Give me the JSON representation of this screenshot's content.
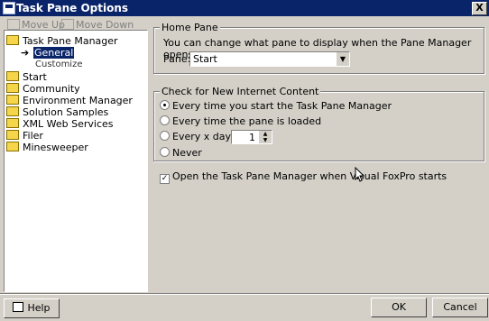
{
  "window": {
    "title": "Task Pane Options",
    "close_label": "X"
  },
  "toolbar": {
    "move_up": "Move Up",
    "move_down": "Move Down"
  },
  "tree": {
    "items": [
      "Task Pane Manager",
      "General",
      "Customize",
      "Start",
      "Community",
      "Environment Manager",
      "Solution Samples",
      "XML Web Services",
      "Filer",
      "Minesweeper"
    ]
  },
  "home_pane": {
    "group_title": "Home Pane",
    "description": "You can change what pane to display when the Pane Manager opens.",
    "pane_label": "Pane:",
    "pane_value": "Start"
  },
  "internet": {
    "group_title": "Check for New Internet Content",
    "options": [
      "Every time you start the Task Pane Manager",
      "Every time the pane is loaded",
      "Every x days:",
      "Never"
    ],
    "days_value": "1"
  },
  "open_option": {
    "label": "Open the Task Pane Manager when Visual FoxPro starts",
    "checked": true
  },
  "buttons": {
    "help": "Help",
    "ok": "OK",
    "cancel": "Cancel"
  }
}
